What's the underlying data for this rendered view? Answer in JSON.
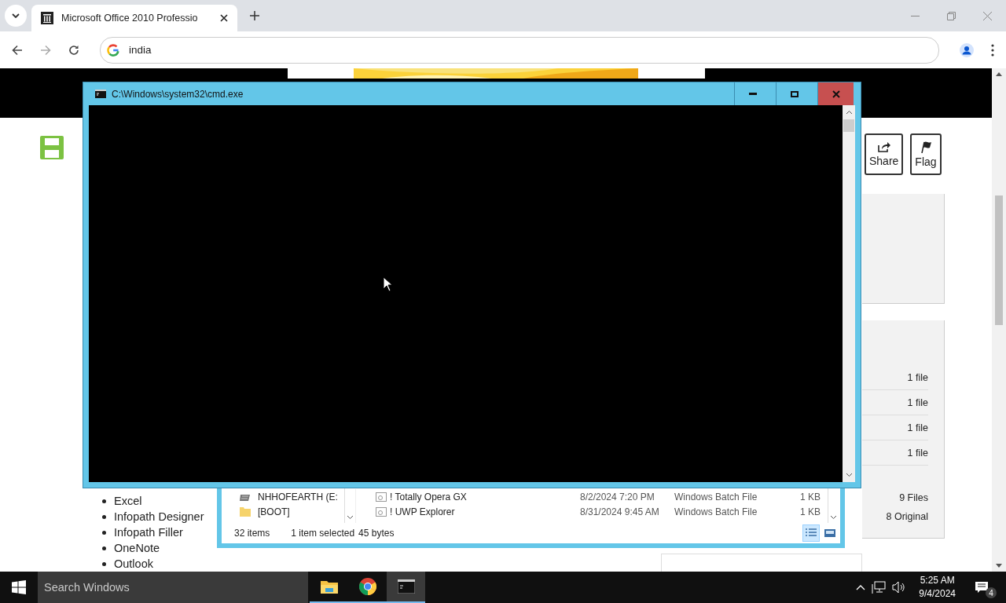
{
  "browser": {
    "tab": {
      "title": "Microsoft Office 2010 Professio",
      "selected": true
    },
    "address": "india"
  },
  "page": {
    "buttons": [
      {
        "kind": "share",
        "label": "Share"
      },
      {
        "kind": "flag",
        "label": "Flag"
      }
    ],
    "file_rows": [
      "1 file",
      "1 file",
      "1 file",
      "1 file"
    ],
    "totals": [
      "9 Files",
      "8 Original"
    ],
    "list": [
      "Excel",
      "Infopath Designer",
      "Infopath Filler",
      "OneNote",
      "Outlook"
    ]
  },
  "explorer": {
    "tree": [
      {
        "kind": "drive",
        "label": "NHHOFEARTH (E:"
      },
      {
        "kind": "folder",
        "label": "[BOOT]"
      }
    ],
    "files": [
      {
        "name": "! Totally Opera GX",
        "date": "8/2/2024 7:20 PM",
        "type": "Windows Batch File",
        "size": "1 KB"
      },
      {
        "name": "! UWP Explorer",
        "date": "8/31/2024 9:45 AM",
        "type": "Windows Batch File",
        "size": "1 KB"
      }
    ],
    "status": {
      "count": "32 items",
      "selection": "1 item selected",
      "size": "45 bytes"
    },
    "views": [
      {
        "kind": "details",
        "selected": true
      },
      {
        "kind": "preview",
        "selected": false
      }
    ]
  },
  "console": {
    "title": "C:\\Windows\\system32\\cmd.exe"
  },
  "taskbar": {
    "search_placeholder": "Search Windows",
    "apps": [
      {
        "kind": "explorer",
        "selected": false
      },
      {
        "kind": "chrome",
        "selected": false
      },
      {
        "kind": "console",
        "selected": true
      }
    ],
    "time": "5:25 AM",
    "date": "9/4/2024",
    "notifications": "4"
  }
}
